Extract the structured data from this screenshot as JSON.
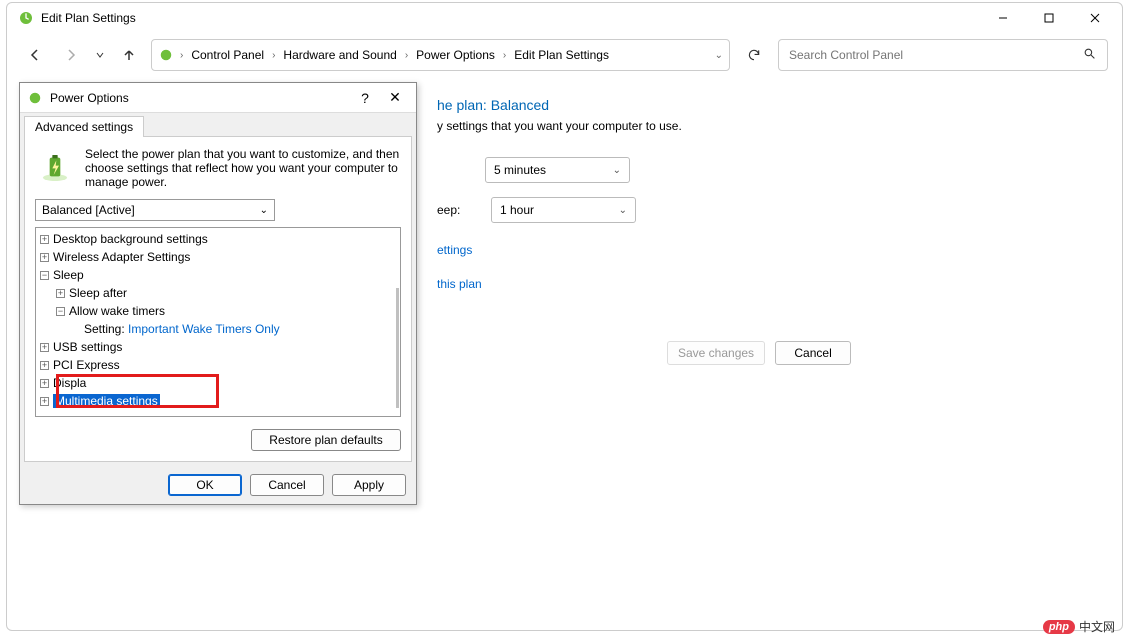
{
  "window": {
    "title": "Edit Plan Settings"
  },
  "breadcrumb": {
    "items": [
      "Control Panel",
      "Hardware and Sound",
      "Power Options",
      "Edit Plan Settings"
    ]
  },
  "search": {
    "placeholder": "Search Control Panel"
  },
  "page": {
    "heading_partial": "he plan: Balanced",
    "subtext_partial": "y settings that you want your computer to use.",
    "sleep_label_partial": "eep:",
    "display_value": "5 minutes",
    "sleep_value": "1 hour",
    "link_settings_partial": "ettings",
    "link_restore_partial": "this plan",
    "save_button": "Save changes",
    "cancel_button": "Cancel"
  },
  "dialog": {
    "title": "Power Options",
    "tab": "Advanced settings",
    "description": "Select the power plan that you want to customize, and then choose settings that reflect how you want your computer to manage power.",
    "plan_selected": "Balanced [Active]",
    "tree": {
      "desktop_bg": "Desktop background settings",
      "wireless": "Wireless Adapter Settings",
      "sleep": "Sleep",
      "sleep_after": "Sleep after",
      "wake_timers": "Allow wake timers",
      "setting_label": "Setting:",
      "setting_value": "Important Wake Timers Only",
      "usb": "USB settings",
      "pci": "PCI Express",
      "display": "Display",
      "multimedia": "Multimedia settings"
    },
    "restore_button": "Restore plan defaults",
    "ok_button": "OK",
    "cancel_button": "Cancel",
    "apply_button": "Apply"
  },
  "watermark": {
    "pill": "php",
    "text": "中文网"
  }
}
